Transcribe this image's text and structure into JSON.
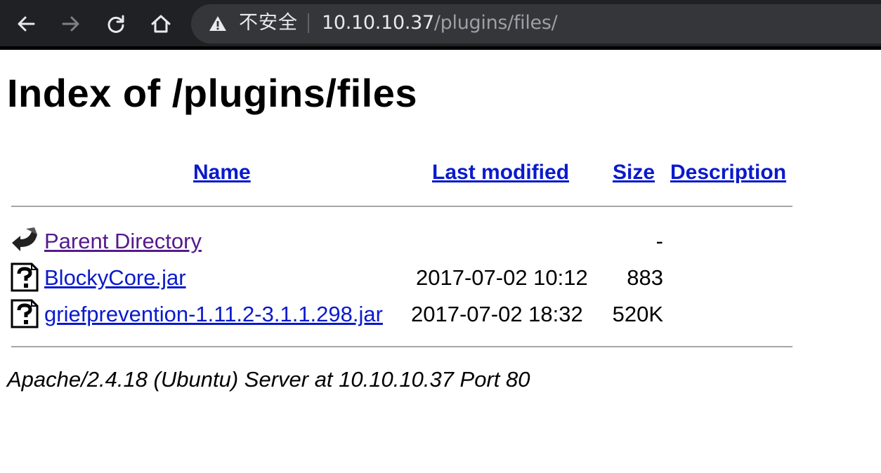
{
  "browser": {
    "security_label": "不安全",
    "url_host": "10.10.10.37",
    "url_path": "/plugins/files/"
  },
  "page": {
    "title": "Index of /plugins/files",
    "columns": {
      "name": "Name",
      "last_modified": "Last modified",
      "size": "Size",
      "description": "Description"
    },
    "rows": [
      {
        "icon": "back-arrow-icon",
        "name": "Parent Directory",
        "modified": "",
        "size": "-",
        "description": ""
      },
      {
        "icon": "unknown-file-icon",
        "name": "BlockyCore.jar",
        "modified": "2017-07-02 10:12",
        "size": "883",
        "description": ""
      },
      {
        "icon": "unknown-file-icon",
        "name": "griefprevention-1.11.2-3.1.1.298.jar",
        "modified": "2017-07-02 18:32",
        "size": "520K",
        "description": ""
      }
    ],
    "footer": "Apache/2.4.18 (Ubuntu) Server at 10.10.10.37 Port 80"
  }
}
